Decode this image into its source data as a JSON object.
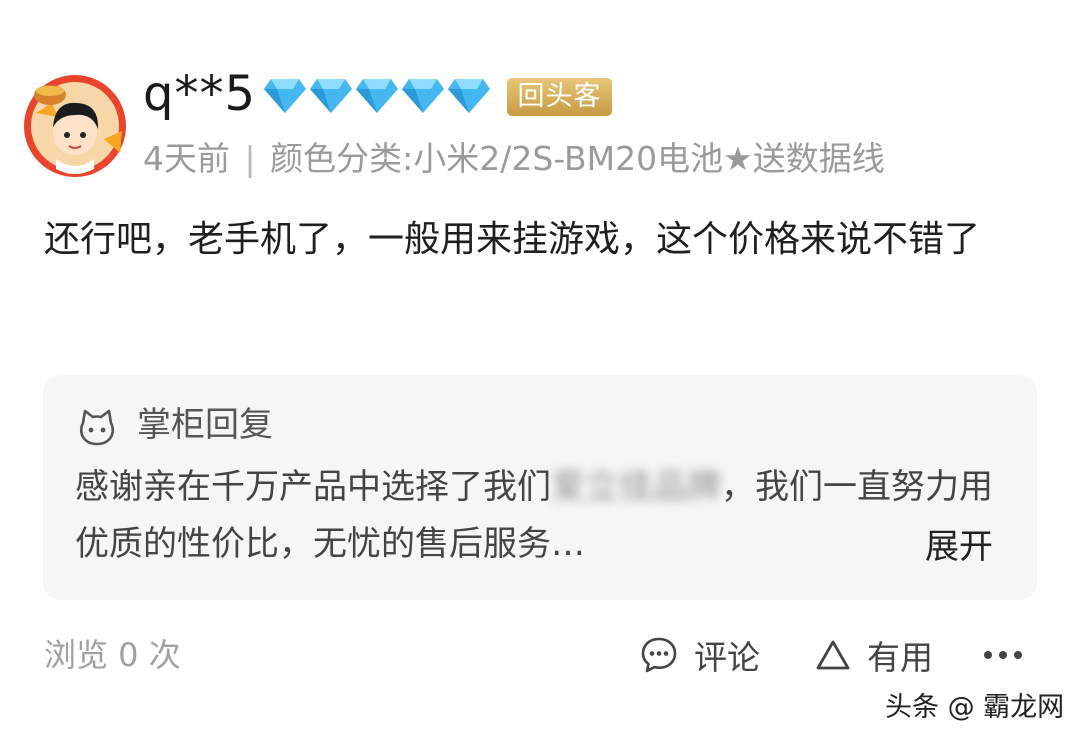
{
  "review": {
    "username": "q**5",
    "diamond_count": 5,
    "badge": "回头客",
    "time": "4天前",
    "separator": "|",
    "variant": "颜色分类:小米2/2S-BM20电池★送数据线",
    "content": "还行吧，老手机了，一般用来挂游戏，这个价格来说不错了"
  },
  "seller_reply": {
    "title": "掌柜回复",
    "text_before": "感谢亲在千万产品中选择了我们",
    "blurred_brand": "爱立佳品牌",
    "text_after": "，我们一直努力用优质的性价比，无忧的售后服务…",
    "expand_label": "展开"
  },
  "footer": {
    "views": "浏览 0 次",
    "comment_label": "评论",
    "useful_label": "有用"
  },
  "watermark": "头条 @ 霸龙网",
  "colors": {
    "diamond": "#45b8f2",
    "badge_gold": "#d4ad5c",
    "reply_bg": "#f6f6f6",
    "meta_gray": "#9a9a9a"
  }
}
